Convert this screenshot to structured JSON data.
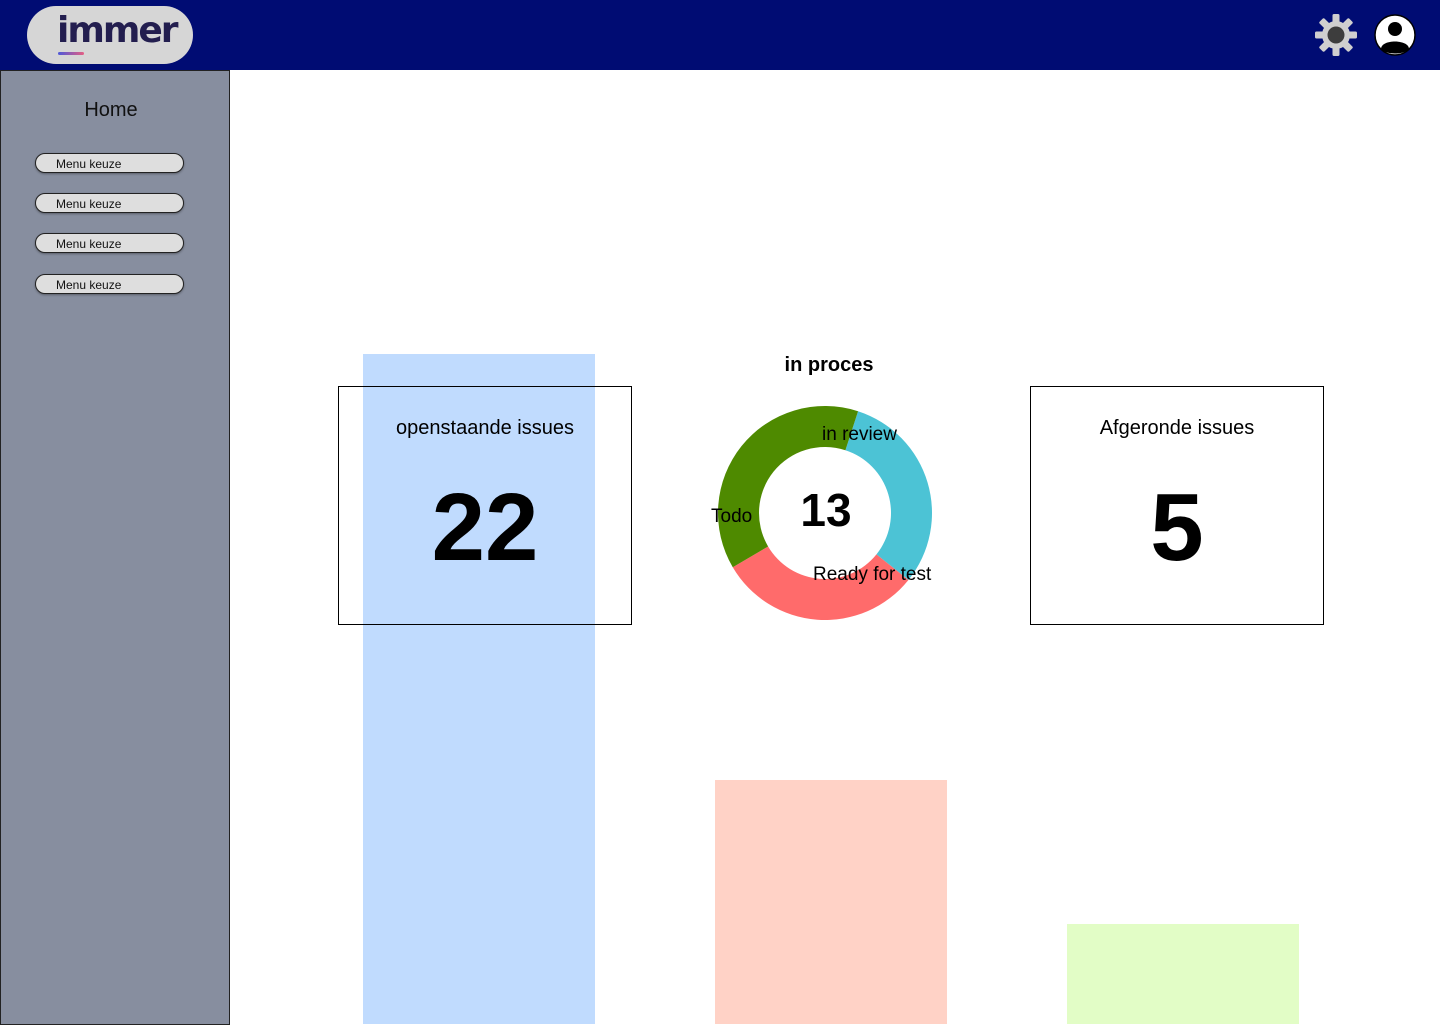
{
  "header": {
    "logo_text": "immer",
    "settings_icon": "gear-icon",
    "profile_icon": "user-icon",
    "background": "#000c73"
  },
  "sidebar": {
    "title": "Home",
    "items": [
      {
        "label": "Menu keuze"
      },
      {
        "label": "Menu keuze"
      },
      {
        "label": "Menu keuze"
      },
      {
        "label": "Menu keuze"
      }
    ]
  },
  "cards": {
    "open": {
      "title": "openstaande issues",
      "value": "22"
    },
    "done": {
      "title": "Afgeronde issues",
      "value": "5"
    }
  },
  "donut": {
    "title": "in proces",
    "total": "13"
  },
  "chart_data": {
    "type": "pie",
    "title": "in proces",
    "center_label": "13",
    "slices": [
      {
        "label": "in review",
        "value": 4,
        "color": "#4cc3d5"
      },
      {
        "label": "Ready for test",
        "value": 4,
        "color": "#ff6b6b"
      },
      {
        "label": "Todo",
        "value": 5,
        "color": "#4e8a00"
      }
    ]
  },
  "background_bars": {
    "type": "bar",
    "values": [
      22,
      8,
      3
    ],
    "colors": [
      "#c0dbfe",
      "#ffd2c6",
      "#e2fdc6"
    ]
  }
}
